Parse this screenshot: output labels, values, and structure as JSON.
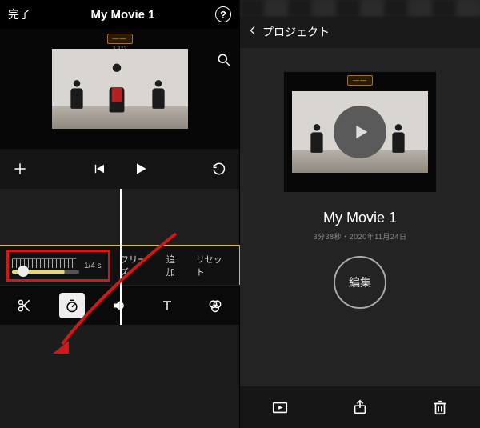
{
  "left": {
    "done": "完了",
    "title": "My Movie 1",
    "help": "?",
    "preview_tag": "——",
    "preview_tag_sub": "3 372",
    "speed": {
      "value_label": "1/4 s",
      "freeze": "フリーズ",
      "add": "追加",
      "reset": "リセット"
    },
    "bottom_icons": [
      "scissors-icon",
      "speed-icon",
      "volume-icon",
      "text-icon",
      "filter-icon"
    ]
  },
  "right": {
    "back": "プロジェクト",
    "title": "My Movie 1",
    "subtitle": "3分38秒・2020年11月24日",
    "edit": "編集",
    "bottom_icons": [
      "play-box-icon",
      "share-icon",
      "trash-icon"
    ]
  }
}
